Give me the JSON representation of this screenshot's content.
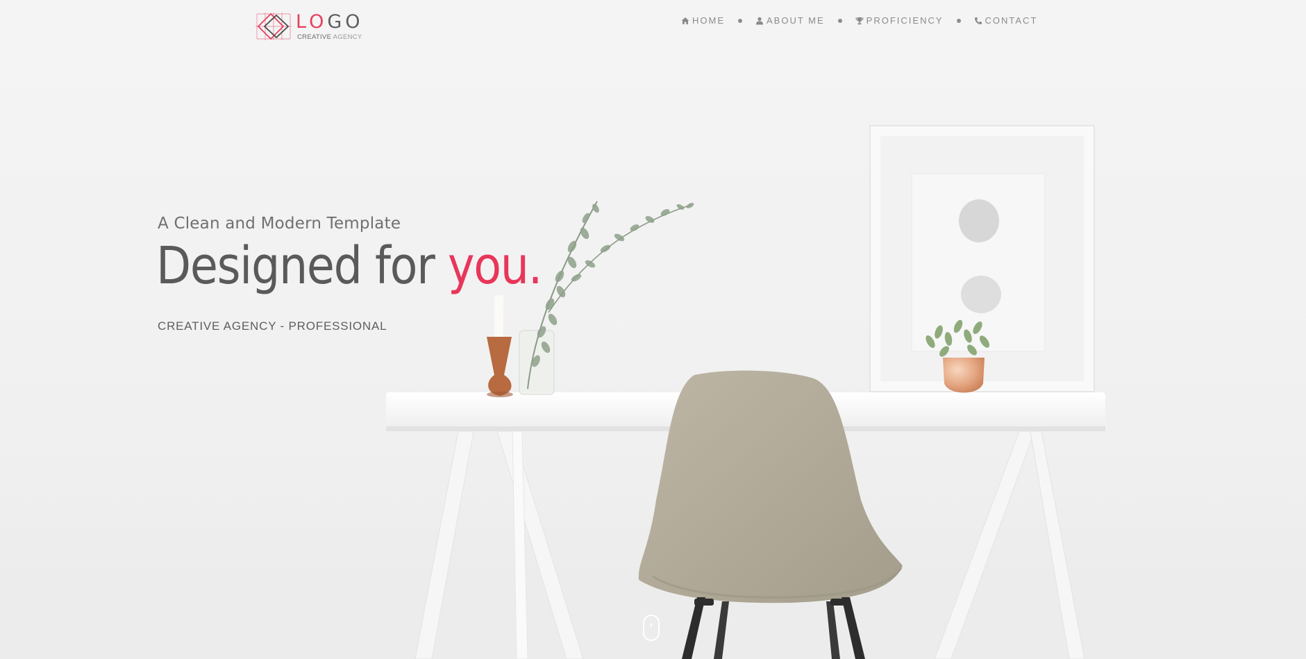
{
  "header": {
    "logo": {
      "word_accent": "LO",
      "word_rest": "GO",
      "tagline_strong": "CREATIVE",
      "tagline_light": "AGENCY"
    },
    "nav": [
      {
        "label": "HOME",
        "icon": "home-icon"
      },
      {
        "label": "ABOUT ME",
        "icon": "user-icon"
      },
      {
        "label": "PROFICIENCY",
        "icon": "trophy-icon"
      },
      {
        "label": "CONTACT",
        "icon": "phone-icon"
      }
    ]
  },
  "hero": {
    "subtitle": "A Clean and Modern Template",
    "headline_main": "Designed for ",
    "headline_accent": "you.",
    "tagline": "CREATIVE AGENCY - PROFESSIONAL",
    "scroll_icon": "mouse-scroll-icon"
  },
  "colors": {
    "accent": "#e8365a",
    "text_dark": "#5a5a5a",
    "nav_text": "#8a8a8a",
    "background": "#f1f1f1"
  }
}
